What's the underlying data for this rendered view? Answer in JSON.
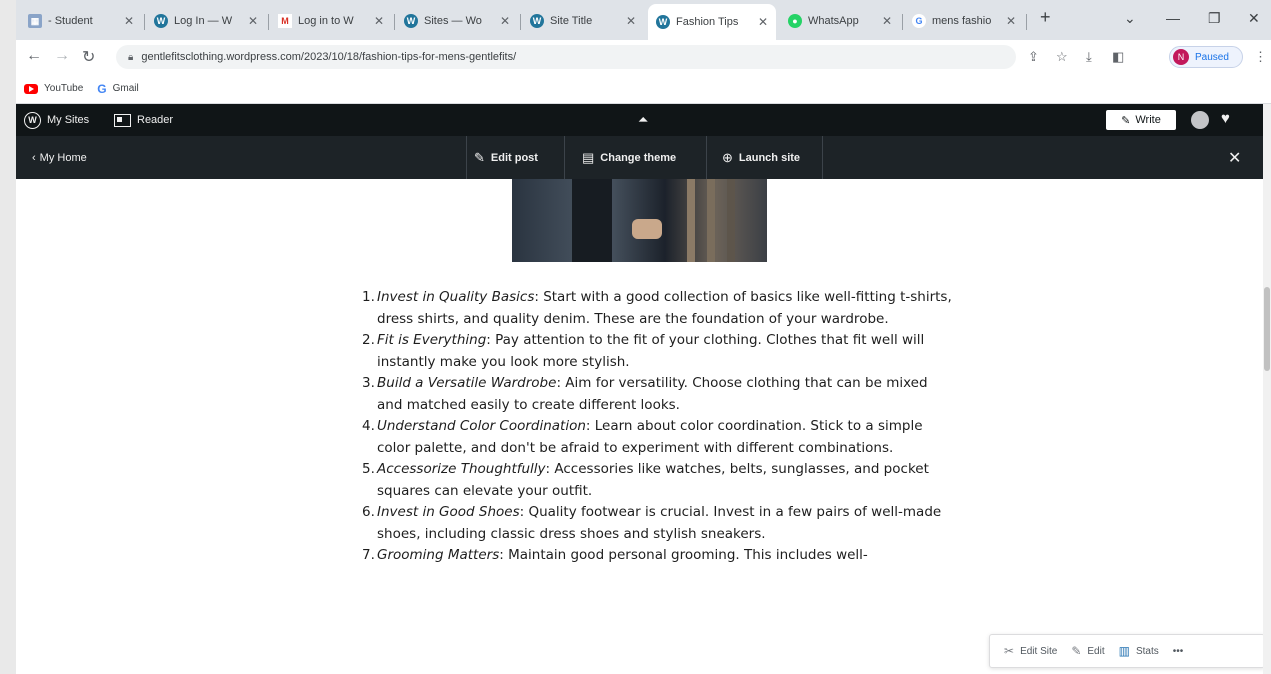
{
  "browser": {
    "tabs": [
      {
        "title": "- Student",
        "favicon": "grid-icon"
      },
      {
        "title": "Log In — W",
        "favicon": "wordpress-icon"
      },
      {
        "title": "Log in to W",
        "favicon": "gmail-icon"
      },
      {
        "title": "Sites — Wo",
        "favicon": "wordpress-icon"
      },
      {
        "title": "Site Title",
        "favicon": "wordpress-icon"
      },
      {
        "title": "Fashion Tips",
        "favicon": "wordpress-icon",
        "active": true
      },
      {
        "title": "WhatsApp",
        "favicon": "whatsapp-icon"
      },
      {
        "title": "mens fashio",
        "favicon": "google-icon"
      }
    ],
    "new_tab_label": "+",
    "url": "gentlefitsclothing.wordpress.com/2023/10/18/fashion-tips-for-mens-gentlefits/",
    "profile_initial": "N",
    "profile_status": "Paused",
    "bookmarks": [
      {
        "label": "YouTube",
        "icon": "youtube-icon"
      },
      {
        "label": "Gmail",
        "icon": "google-icon"
      }
    ]
  },
  "adminbar": {
    "my_sites": "My Sites",
    "reader": "Reader",
    "write": "Write"
  },
  "subbar": {
    "my_home": "My Home",
    "edit_post": "Edit post",
    "change_theme": "Change theme",
    "launch_site": "Launch site"
  },
  "article": {
    "items": [
      {
        "num": "1.",
        "lead": "Invest in Quality Basics",
        "text": ": Start with a good collection of basics like well-fitting t-shirts, dress shirts, and quality denim. These are the foundation of your wardrobe."
      },
      {
        "num": "2.",
        "lead": "Fit is Everything",
        "text": ": Pay attention to the fit of your clothing. Clothes that fit well will instantly make you look more stylish."
      },
      {
        "num": "3.",
        "lead": "Build a Versatile Wardrobe",
        "text": ": Aim for versatility. Choose clothing that can be mixed and matched easily to create different looks."
      },
      {
        "num": "4.",
        "lead": "Understand Color Coordination",
        "text": ": Learn about color coordination. Stick to a simple color palette, and don't be afraid to experiment with different combinations."
      },
      {
        "num": "5.",
        "lead": "Accessorize Thoughtfully",
        "text": ": Accessories like watches, belts, sunglasses, and pocket squares can elevate your outfit."
      },
      {
        "num": "6.",
        "lead": "Invest in Good Shoes",
        "text": ": Quality footwear is crucial. Invest in a few pairs of well-made shoes, including classic dress shoes and stylish sneakers."
      },
      {
        "num": "7.",
        "lead": "Grooming Matters",
        "text": ": Maintain good personal grooming. This includes well-"
      }
    ]
  },
  "floatbar": {
    "edit_site": "Edit Site",
    "edit": "Edit",
    "stats": "Stats",
    "more": "•••"
  },
  "colors": {
    "adminbar_bg": "#101517",
    "subbar_bg": "#1d2327",
    "accent": "#2271b1"
  }
}
